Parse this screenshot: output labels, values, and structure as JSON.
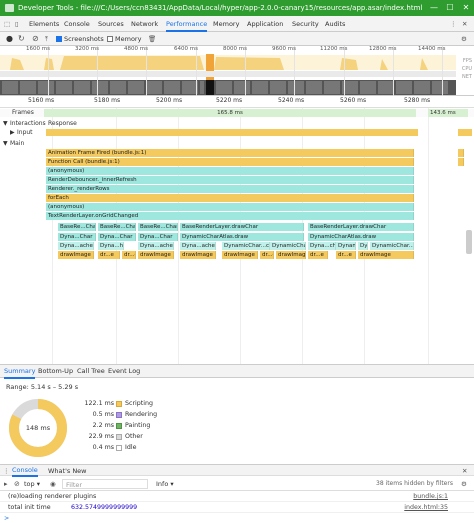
{
  "titlebar": {
    "title": "Developer Tools - file:///C:/Users/ccn83431/AppData/Local/hyper/app-2.0.0-canary15/resources/app.asar/index.html",
    "min": "—",
    "max": "☐",
    "close": "✕"
  },
  "tabs": [
    "Elements",
    "Console",
    "Sources",
    "Network",
    "Performance",
    "Memory",
    "Application",
    "Security",
    "Audits"
  ],
  "active_tab": "Performance",
  "toolbar": {
    "screenshots_label": "Screenshots",
    "memory_label": "Memory"
  },
  "overview": {
    "ticks": [
      "1600 ms",
      "3200 ms",
      "4800 ms",
      "6400 ms",
      "8000 ms",
      "9600 ms",
      "11200 ms",
      "12800 ms",
      "14400 ms"
    ],
    "labels": [
      "FPS",
      "CPU",
      "NET"
    ]
  },
  "ruler": {
    "ticks": [
      "5160 ms",
      "5180 ms",
      "5200 ms",
      "5220 ms",
      "5240 ms",
      "5260 ms",
      "5280 ms"
    ]
  },
  "frames": {
    "label": "Frames",
    "frame1": "165.8 ms",
    "frame2": "143.6 ms"
  },
  "interactions": {
    "label": "Interactions",
    "input_label": "Input",
    "response_label": "Response"
  },
  "main": {
    "label": "Main"
  },
  "flame": {
    "rows": [
      {
        "label": "Animation Frame Fired (bundle.js:1)",
        "color": "#f4c95d"
      },
      {
        "label": "Function Call (bundle.js:1)",
        "color": "#f4c95d"
      },
      {
        "label": "(anonymous)",
        "color": "#9ee7df"
      },
      {
        "label": "RenderDebouncer._innerRefresh",
        "color": "#9ee7df"
      },
      {
        "label": "Renderer._renderRows",
        "color": "#9ee7df"
      },
      {
        "label": "forEach",
        "color": "#f4c95d"
      },
      {
        "label": "(anonymous)",
        "color": "#9ee7df"
      },
      {
        "label": "TextRenderLayer.onGridChanged",
        "color": "#9ee7df"
      }
    ],
    "row9": [
      "BaseRe...Char",
      "BaseRe...Char",
      "BaseRe...Char",
      "BaseRenderLayer.drawChar",
      "BaseRenderLayer.drawChar"
    ],
    "row10": [
      "Dyna...Char",
      "Dyna...Char",
      "Dyna...Char",
      "DynamicCharAtlas.draw",
      "DynamicCharAtlas.draw"
    ],
    "row11": [
      "Dyna...ache",
      "Dyna...he",
      "Dyna...ache",
      "Dyna...ache",
      "DynamicChar...che",
      "DynamicChar...omCache",
      "Dyna...che",
      "DynamicCha...che",
      "Dy...he",
      "DynamicChar...Cache"
    ],
    "row12": [
      "drawImage",
      "dr...e",
      "dr...e",
      "drawImage",
      "drawImage",
      "drawImage",
      "dr...e",
      "drawImage",
      "dr...e",
      "dr...e",
      "drawImage"
    ]
  },
  "bottom_tabs": [
    "Summary",
    "Bottom-Up",
    "Call Tree",
    "Event Log"
  ],
  "summary": {
    "range": "Range: 5.14 s – 5.29 s",
    "total": "148 ms",
    "items": [
      {
        "value": "122.1 ms",
        "label": "Scripting",
        "color": "#f4c95d"
      },
      {
        "value": "0.5 ms",
        "label": "Rendering",
        "color": "#af9be0"
      },
      {
        "value": "2.2 ms",
        "label": "Painting",
        "color": "#71b364"
      },
      {
        "value": "22.9 ms",
        "label": "Other",
        "color": "#dadada"
      },
      {
        "value": "0.4 ms",
        "label": "Idle",
        "color": "#ffffff"
      }
    ]
  },
  "console": {
    "tabs": [
      "Console",
      "What's New"
    ],
    "context": "top",
    "filter_placeholder": "Filter",
    "level": "Info",
    "hidden": "38 items hidden by filters",
    "lines": [
      {
        "text": "(re)loading renderer plugins",
        "source": "bundle.js:1"
      },
      {
        "text": "total init time",
        "value": "632.5749999999999",
        "source": "index.html:35"
      }
    ],
    "prompt": ">"
  }
}
